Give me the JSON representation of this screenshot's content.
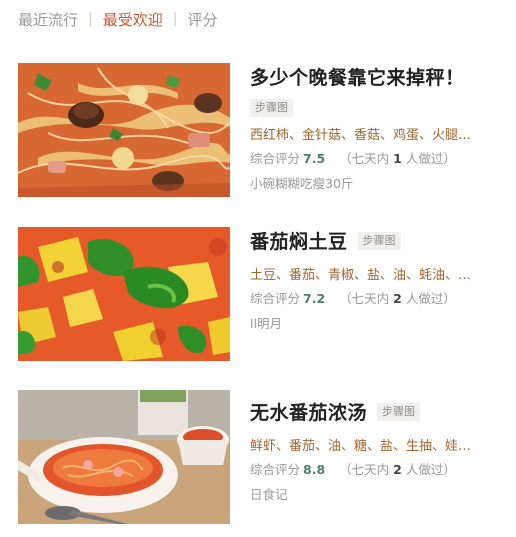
{
  "tabs": [
    {
      "label": "最近流行",
      "active": false
    },
    {
      "label": "最受欢迎",
      "active": true
    },
    {
      "label": "评分",
      "active": false
    }
  ],
  "separator": "|",
  "colors": {
    "accent": "#c85a2e",
    "ingredients": "#a0662f",
    "score": "#4f7f6f",
    "muted": "#999999"
  },
  "recipes": [
    {
      "title": "多少个晚餐靠它来掉秤！",
      "badge": "步骤图",
      "ingredients": "西红柿、金针菇、香菇、鸡蛋、火腿…",
      "rating_label": "综合评分",
      "score": "7.5",
      "stat_prefix": "（七天内",
      "stat_count": "1",
      "stat_suffix": "人做过）",
      "author": "小碗糊糊吃瘦30斤",
      "image": "noodle-soup-photo"
    },
    {
      "title": "番茄焖土豆",
      "badge": "步骤图",
      "ingredients": "土豆、番茄、青椒、盐、油、蚝油、…",
      "rating_label": "综合评分",
      "score": "7.2",
      "stat_prefix": "（七天内",
      "stat_count": "2",
      "stat_suffix": "人做过）",
      "author": "ll明月",
      "image": "tomato-potato-photo"
    },
    {
      "title": "无水番茄浓汤",
      "badge": "步骤图",
      "ingredients": "鲜虾、番茄、油、糖、盐、生抽、娃…",
      "rating_label": "综合评分",
      "score": "8.8",
      "stat_prefix": "（七天内",
      "stat_count": "2",
      "stat_suffix": "人做过）",
      "author": "日食记",
      "image": "tomato-soup-photo"
    }
  ]
}
